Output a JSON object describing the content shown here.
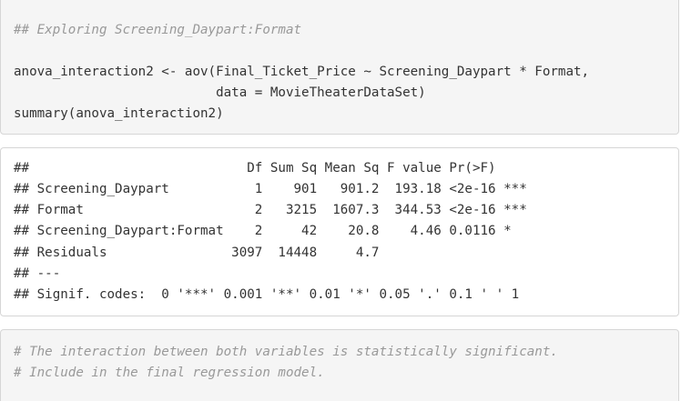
{
  "code_block_1": {
    "lines": [
      "## Exploring Screening_Daypart:Format",
      "anova_interaction2 <- aov(Final_Ticket_Price ~ Screening_Daypart * Format,",
      "                          data = MovieTheaterDataSet)",
      "summary(anova_interaction2)"
    ]
  },
  "output_block": {
    "lines": [
      "##                            Df Sum Sq Mean Sq F value Pr(>F)    ",
      "## Screening_Daypart           1    901   901.2  193.18 <2e-16 ***",
      "## Format                      2   3215  1607.3  344.53 <2e-16 ***",
      "## Screening_Daypart:Format    2     42    20.8    4.46 0.0116 *  ",
      "## Residuals                3097  14448     4.7                   ",
      "## ---",
      "## Signif. codes:  0 '***' 0.001 '**' 0.01 '*' 0.05 '.' 0.1 ' ' 1"
    ]
  },
  "code_block_2": {
    "lines": [
      "# The interaction between both variables is statistically significant.",
      "# Include in the final regression model."
    ]
  },
  "colors": {
    "code_background": "#f5f5f5",
    "output_background": "#ffffff",
    "border": "#d6d6d6",
    "comment_text": "#999999",
    "code_text": "#333333"
  }
}
